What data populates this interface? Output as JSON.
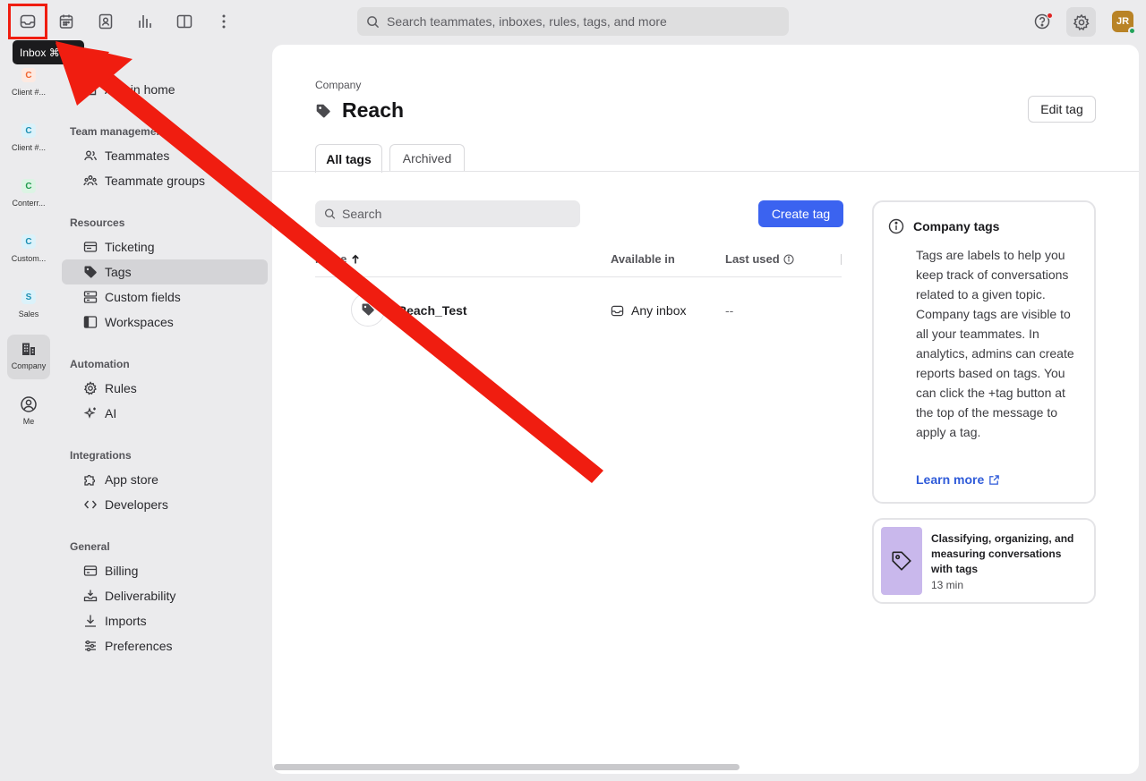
{
  "topbar": {
    "search_placeholder": "Search teammates, inboxes, rules, tags, and more",
    "tooltip": "Inbox ⌘1",
    "avatar_initials": "JR",
    "icons": [
      "inbox-icon",
      "calendar-icon",
      "contacts-icon",
      "analytics-icon",
      "book-icon",
      "more-icon",
      "help-icon",
      "gear-icon"
    ]
  },
  "rail": [
    {
      "badge": "C",
      "label": "Client #...",
      "color": "#f0652f",
      "bg": "#fde9e1"
    },
    {
      "badge": "C",
      "label": "Client #...",
      "color": "#1c8fb3",
      "bg": "#dbf2fa"
    },
    {
      "badge": "C",
      "label": "Conterr...",
      "color": "#1f9a4c",
      "bg": "#dcf4e4"
    },
    {
      "badge": "C",
      "label": "Custom...",
      "color": "#1c8fb3",
      "bg": "#dbf2fa"
    },
    {
      "badge": "S",
      "label": "Sales",
      "color": "#1c8fb3",
      "bg": "#dbf2fa"
    },
    {
      "label": "Company"
    },
    {
      "label": "Me"
    }
  ],
  "nav": {
    "admin_home": "Admin home",
    "sections": {
      "team": "Team management",
      "resources": "Resources",
      "automation": "Automation",
      "integrations": "Integrations",
      "general": "General"
    },
    "items": {
      "teammates": "Teammates",
      "teammate_groups": "Teammate groups",
      "ticketing": "Ticketing",
      "tags": "Tags",
      "custom_fields": "Custom fields",
      "workspaces": "Workspaces",
      "rules": "Rules",
      "ai": "AI",
      "app_store": "App store",
      "developers": "Developers",
      "billing": "Billing",
      "deliverability": "Deliverability",
      "imports": "Imports",
      "preferences": "Preferences"
    }
  },
  "main": {
    "breadcrumb": "Company",
    "title": "Reach",
    "edit_button": "Edit tag",
    "tabs": [
      "All tags",
      "Archived"
    ],
    "search_placeholder": "Search",
    "create_button": "Create tag",
    "columns": {
      "name": "Name",
      "available": "Available in",
      "last_used": "Last used"
    },
    "rows": [
      {
        "name": "Reach_Test",
        "available": "Any inbox",
        "last_used": "--"
      }
    ],
    "info": {
      "title": "Company tags",
      "body": "Tags are labels to help you keep track of conversations related to a given topic. Company tags are visible to all your teammates. In analytics, admins can create reports based on tags. You can click the +tag button at the top of the message to apply a tag.",
      "learn_more": "Learn more"
    },
    "course": {
      "title": "Classifying, organizing, and measuring conversations with tags",
      "duration": "13 min"
    }
  },
  "colors": {
    "accent": "#3b63f0",
    "annotation_red": "#f01d10"
  }
}
